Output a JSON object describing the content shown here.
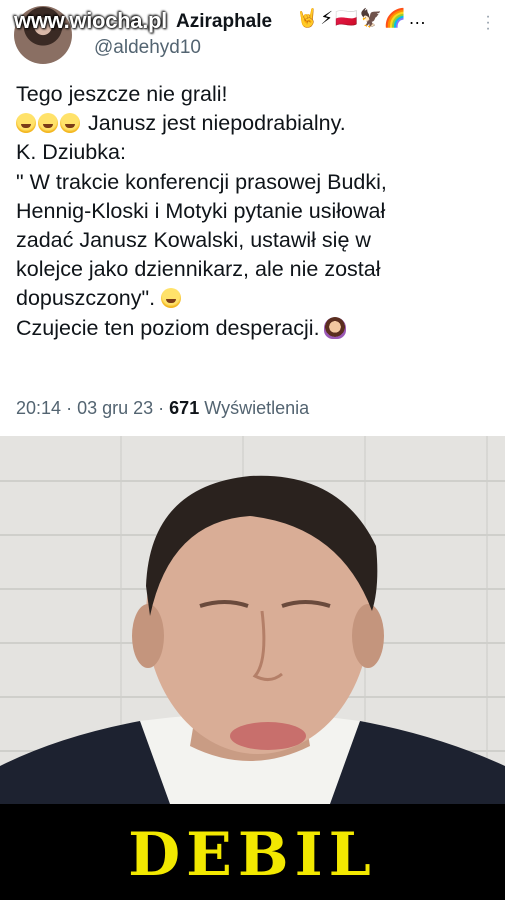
{
  "tweet": {
    "display_name": "Aziraphale",
    "badges": "🤘⚡🇵🇱🦅🌈…",
    "handle": "@aldehyd10",
    "more_icon": "more-dots-icon",
    "lines": [
      "Tego jeszcze nie grali!",
      "Janusz jest niepodrabialny.",
      "K. Dziubka:",
      "\" W trakcie konferencji prasowej Budki,",
      "Hennig-Kloski i Motyki pytanie usiłował",
      "zadać Janusz Kowalski, ustawił się w",
      "kolejce jako dziennikarz, ale nie został",
      "dopuszczony\".",
      "Czujecie ten poziom desperacji."
    ],
    "time": "20:14",
    "separator": "·",
    "date": "03 gru 23",
    "views_count": "671",
    "views_label": "Wyświetlenia"
  },
  "watermark": "www.wiocha.pl",
  "caption": "DEBIL",
  "colors": {
    "caption_text": "#f2e800",
    "caption_bg": "#000000",
    "meta_text": "#536471"
  }
}
